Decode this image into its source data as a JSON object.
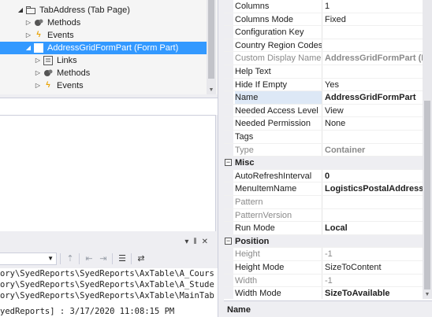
{
  "tree": {
    "items": [
      {
        "label": "",
        "icon": "tab-page-icon"
      },
      {
        "label": "TabAddress (Tab Page)",
        "icon": "tab-page-icon"
      },
      {
        "label": "Methods",
        "icon": "methods-icon"
      },
      {
        "label": "Events",
        "icon": "events-icon"
      },
      {
        "label": "AddressGridFormPart (Form Part)",
        "icon": "form-part-icon"
      },
      {
        "label": "Links",
        "icon": "links-icon"
      },
      {
        "label": "Methods",
        "icon": "methods-icon"
      },
      {
        "label": "Events",
        "icon": "events-icon"
      }
    ]
  },
  "output": {
    "lines": [
      "ory\\SyedReports\\SyedReports\\AxTable\\A_Cours",
      "ory\\SyedReports\\SyedReports\\AxTable\\A_Stude",
      "ory\\SyedReports\\SyedReports\\AxTable\\MainTab",
      "yedReports] : 3/17/2020 11:08:15 PM"
    ]
  },
  "properties": {
    "rows": [
      {
        "name": "Columns",
        "value": "1",
        "bold": false,
        "readonly": false
      },
      {
        "name": "Columns Mode",
        "value": "Fixed",
        "bold": false,
        "readonly": false
      },
      {
        "name": "Configuration Key",
        "value": "",
        "bold": false,
        "readonly": false
      },
      {
        "name": "Country Region Codes",
        "value": "",
        "bold": false,
        "readonly": false
      },
      {
        "name": "Custom Display Name",
        "value": "AddressGridFormPart (Fo",
        "bold": true,
        "readonly": true
      },
      {
        "name": "Help Text",
        "value": "",
        "bold": false,
        "readonly": false
      },
      {
        "name": "Hide If Empty",
        "value": "Yes",
        "bold": false,
        "readonly": false
      },
      {
        "name": "Name",
        "value": "AddressGridFormPart",
        "bold": true,
        "readonly": false,
        "selected": true
      },
      {
        "name": "Needed Access Level",
        "value": "View",
        "bold": false,
        "readonly": false
      },
      {
        "name": "Needed Permission",
        "value": "None",
        "bold": false,
        "readonly": false
      },
      {
        "name": "Tags",
        "value": "",
        "bold": false,
        "readonly": false
      },
      {
        "name": "Type",
        "value": "Container",
        "bold": true,
        "readonly": true
      },
      {
        "category": true,
        "name": "Misc"
      },
      {
        "name": "AutoRefreshInterval",
        "value": "0",
        "bold": true,
        "readonly": false
      },
      {
        "name": "MenuItemName",
        "value": "LogisticsPostalAddressGr",
        "bold": true,
        "readonly": false
      },
      {
        "name": "Pattern",
        "value": "",
        "bold": false,
        "readonly": true
      },
      {
        "name": "PatternVersion",
        "value": "",
        "bold": false,
        "readonly": true
      },
      {
        "name": "Run Mode",
        "value": "Local",
        "bold": true,
        "readonly": false
      },
      {
        "category": true,
        "name": "Position"
      },
      {
        "name": "Height",
        "value": "-1",
        "bold": false,
        "readonly": true
      },
      {
        "name": "Height Mode",
        "value": "SizeToContent",
        "bold": false,
        "readonly": false
      },
      {
        "name": "Width",
        "value": "-1",
        "bold": false,
        "readonly": true
      },
      {
        "name": "Width Mode",
        "value": "SizeToAvailable",
        "bold": true,
        "readonly": false
      }
    ]
  },
  "description": {
    "title": "Name"
  },
  "colors": {
    "selection": "#3399ff",
    "panel": "#eeeef2",
    "readonly_text": "#8a8a8a"
  }
}
